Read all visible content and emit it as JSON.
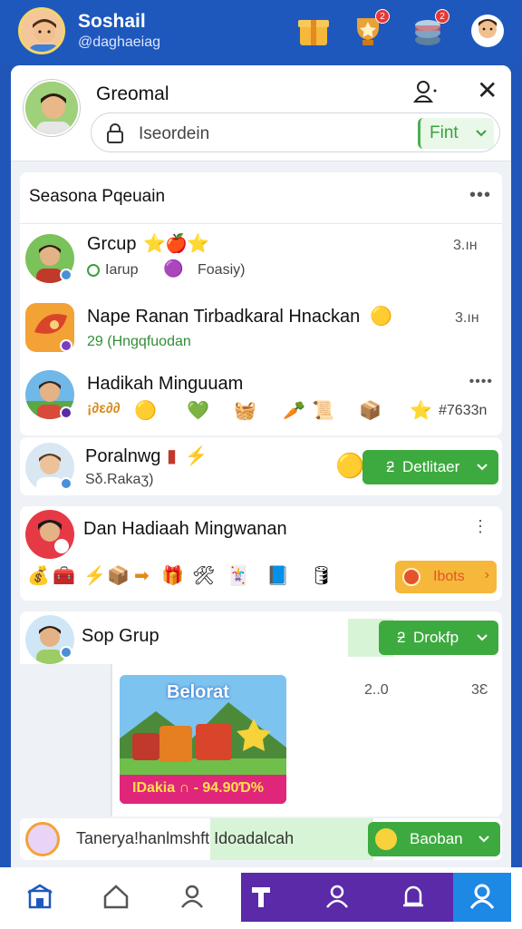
{
  "app": {
    "title": "Soshail",
    "handle": "@daghaeiag"
  },
  "top_icons": [
    "gift-box-icon",
    "trophy-icon",
    "coins-stack-icon",
    "profile-icon"
  ],
  "top_badges": {
    "trophy": "2",
    "coins": "2"
  },
  "panel": {
    "title": "Greomal",
    "search_placeholder": "Iseordein",
    "filter_label": "Fint",
    "close": "✕"
  },
  "section": {
    "title": "Seasona Pqeuain",
    "more": "•••"
  },
  "rows": [
    {
      "name": "Grcup",
      "sub_left": "Iarup",
      "sub_right": "Foasiy)",
      "time": "3.ıн"
    },
    {
      "name": "Nape Ranan Tirbadkaral Hnackan",
      "sub": "29 (Hngqfuodan",
      "time": "3.ıн"
    },
    {
      "name": "Hadikah Minguuam",
      "values": "¡∂ε∂∂",
      "extra": "#7633n",
      "more": "••••"
    }
  ],
  "card_pora": {
    "name": "Poralnwg",
    "sub": "Sδ.Rakaʒ)",
    "button": "Detlitaer",
    "button_prefix": "ƻ"
  },
  "card_dan": {
    "title": "Dan Hadiaah Mingwanan",
    "button": "Ibots"
  },
  "card_sop": {
    "name": "Sop Grup",
    "button": "Drokfp",
    "button_prefix": "ƻ",
    "banner_title": "Belorat",
    "banner_price": "IDakia ∩ - 94.90Ɗ%",
    "stat_left": "2..0",
    "stat_right": "3Ɛ"
  },
  "footer_bar": {
    "text": "Tanerya!hanlmshft Idoadalcah",
    "button": "Baoban"
  },
  "colors": {
    "primary": "#1e58bd",
    "green": "#3daa3f",
    "purple": "#5a2aa8",
    "active": "#1e88e5",
    "orange": "#f5b83a"
  }
}
